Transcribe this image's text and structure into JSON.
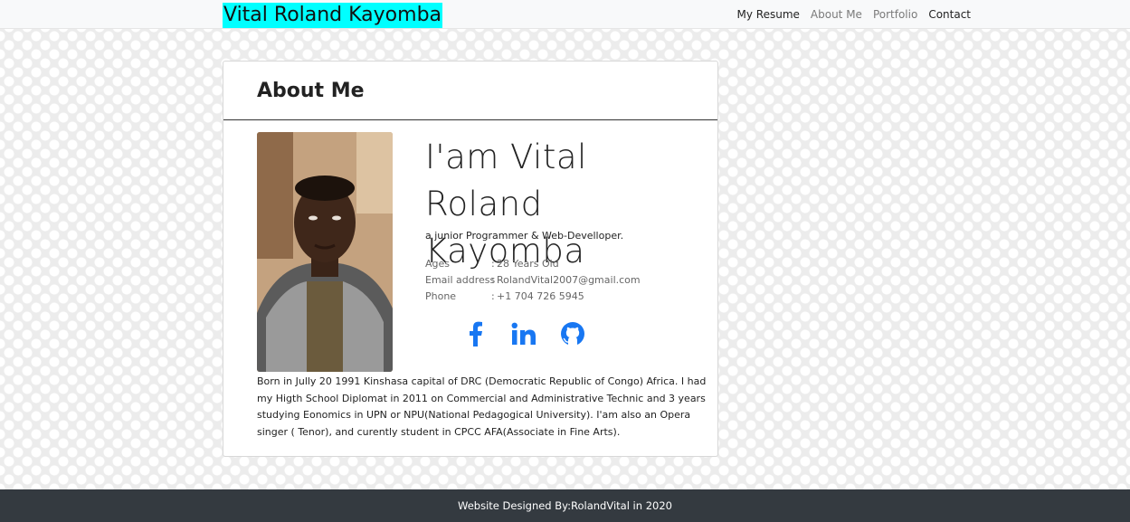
{
  "navbar": {
    "brand": "Vital Roland Kayomba",
    "links": [
      {
        "label": "My Resume",
        "style": "dark"
      },
      {
        "label": "About Me",
        "style": "muted"
      },
      {
        "label": "Portfolio",
        "style": "muted"
      },
      {
        "label": "Contact",
        "style": "dark"
      }
    ]
  },
  "about": {
    "title": "About Me",
    "name_line1": "I'am Vital Roland",
    "name_line2": "Kayomba",
    "subtitle": "a junior Programmer & Web-Develloper.",
    "info": [
      {
        "label": "Ages",
        "value": "28 Years Old"
      },
      {
        "label": "Email address",
        "value": "RolandVital2007@gmail.com"
      },
      {
        "label": "Phone",
        "value": "+1 704 726 5945"
      }
    ],
    "info_separator": ":",
    "socials": [
      {
        "icon": "facebook-icon",
        "color": "#1877f2"
      },
      {
        "icon": "linkedin-icon",
        "color": "#1877f2"
      },
      {
        "icon": "github-icon",
        "color": "#1877f2"
      }
    ],
    "bio": "Born in Jully 20 1991 Kinshasa capital of DRC (Democratic Republic of Congo) Africa. I had my Higth School Diplomat in 2011 on Commercial and Administrative Technic and 3 years studying Eonomics in UPN or NPU(National Pedagogical University). I'am also an Opera singer ( Tenor), and curently student in CPCC AFA(Associate in Fine Arts)."
  },
  "footer": {
    "text": "Website Designed By:RolandVital in 2020"
  },
  "colors": {
    "brand_highlight": "#00ffff",
    "social_blue": "#1877f2",
    "footer_bg": "#343a40"
  }
}
